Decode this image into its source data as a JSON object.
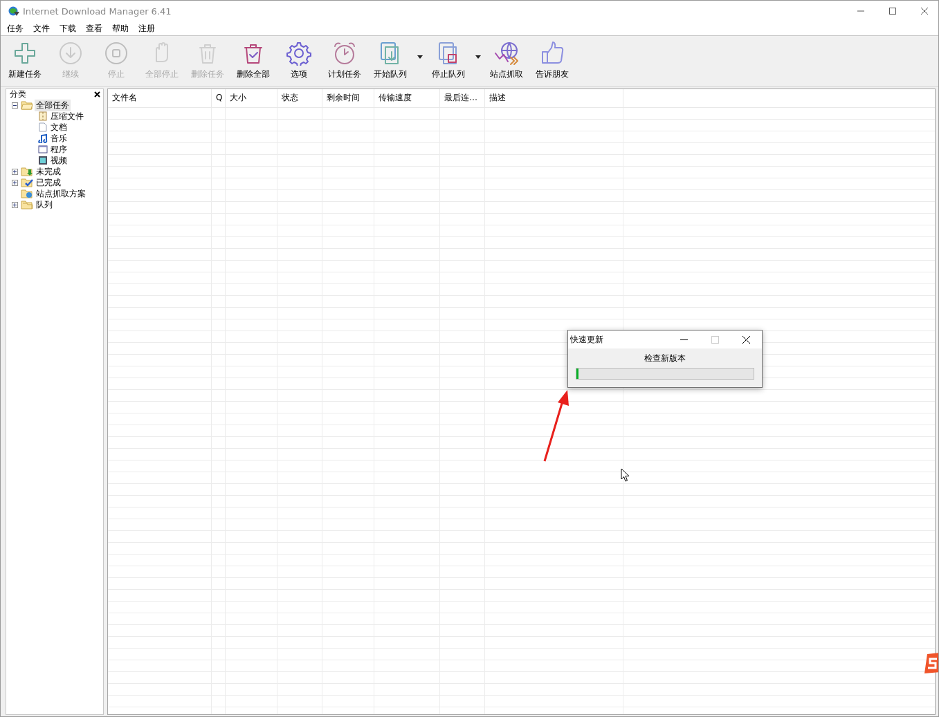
{
  "window": {
    "title": "Internet Download Manager 6.41"
  },
  "menu": [
    "任务",
    "文件",
    "下载",
    "查看",
    "帮助",
    "注册"
  ],
  "toolbar": [
    {
      "label": "新建任务",
      "disabled": false,
      "dropdown": false
    },
    {
      "label": "继续",
      "disabled": true,
      "dropdown": false
    },
    {
      "label": "停止",
      "disabled": true,
      "dropdown": false
    },
    {
      "label": "全部停止",
      "disabled": true,
      "dropdown": false
    },
    {
      "label": "删除任务",
      "disabled": true,
      "dropdown": false
    },
    {
      "label": "删除全部",
      "disabled": false,
      "dropdown": false
    },
    {
      "label": "选项",
      "disabled": false,
      "dropdown": false
    },
    {
      "label": "计划任务",
      "disabled": false,
      "dropdown": false
    },
    {
      "label": "开始队列",
      "disabled": false,
      "dropdown": true
    },
    {
      "label": "停止队列",
      "disabled": false,
      "dropdown": true
    },
    {
      "label": "站点抓取",
      "disabled": false,
      "dropdown": false
    },
    {
      "label": "告诉朋友",
      "disabled": false,
      "dropdown": false
    }
  ],
  "sidebar": {
    "title": "分类",
    "tree": [
      {
        "label": "全部任务",
        "kind": "folder-open",
        "expanded": true,
        "selected": true,
        "children": [
          {
            "label": "压缩文件",
            "kind": "archive",
            "selected": false
          },
          {
            "label": "文档",
            "kind": "document",
            "selected": false
          },
          {
            "label": "音乐",
            "kind": "music",
            "selected": false
          },
          {
            "label": "程序",
            "kind": "program",
            "selected": false
          },
          {
            "label": "视频",
            "kind": "video",
            "selected": false
          }
        ]
      },
      {
        "label": "未完成",
        "kind": "incomplete",
        "expanded": false,
        "selected": false
      },
      {
        "label": "已完成",
        "kind": "complete",
        "expanded": false,
        "selected": false
      },
      {
        "label": "站点抓取方案",
        "kind": "grabber",
        "selected": false
      },
      {
        "label": "队列",
        "kind": "queues",
        "expanded": false,
        "selected": false
      }
    ]
  },
  "table": {
    "columns": [
      "文件名",
      "Q",
      "大小",
      "状态",
      "剩余时间",
      "传输速度",
      "最后连…",
      "描述"
    ]
  },
  "dialog": {
    "title": "快速更新",
    "message": "检查新版本",
    "progress": {
      "level": 0.01
    }
  }
}
